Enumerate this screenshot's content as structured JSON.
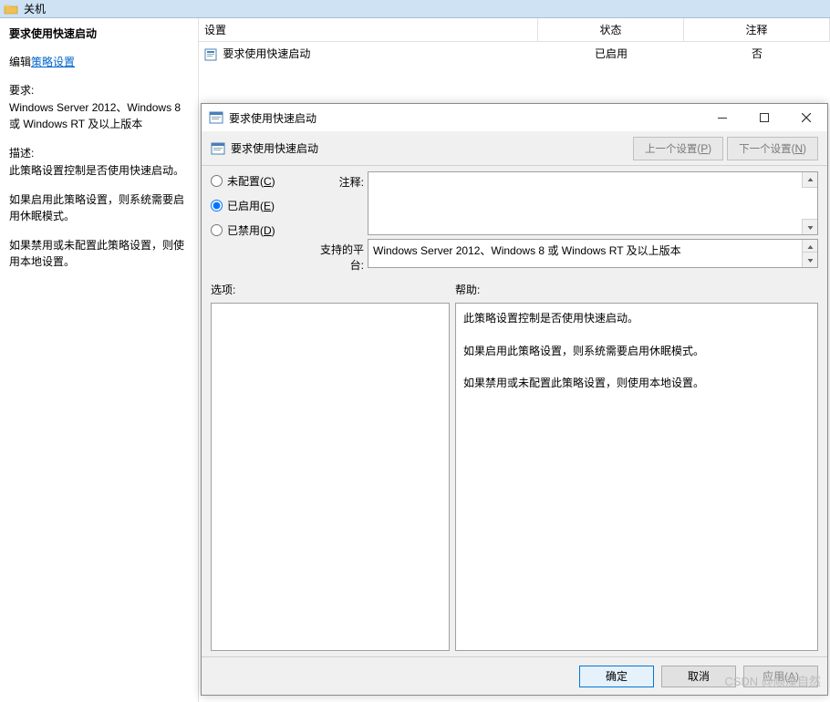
{
  "bg": {
    "title": "关机",
    "left": {
      "policy_title": "要求使用快速启动",
      "edit_prefix": "编辑",
      "edit_link": "策略设置",
      "req_label": "要求:",
      "req_text": "Windows Server 2012、Windows 8 或 Windows RT 及以上版本",
      "desc_label": "描述:",
      "desc_text": "此策略设置控制是否使用快速启动。",
      "p1": "如果启用此策略设置，则系统需要启用休眠模式。",
      "p2": "如果禁用或未配置此策略设置，则使用本地设置。"
    },
    "table": {
      "h_setting": "设置",
      "h_state": "状态",
      "h_comment": "注释",
      "r_setting": "要求使用快速启动",
      "r_state": "已启用",
      "r_comment": "否"
    }
  },
  "dialog": {
    "title": "要求使用快速启动",
    "toolbar_title": "要求使用快速启动",
    "prev_btn": "上一个设置(P)",
    "next_btn": "下一个设置(N)",
    "radio_notconfig": "未配置(C)",
    "radio_enabled": "已启用(E)",
    "radio_disabled": "已禁用(D)",
    "label_comment": "注释:",
    "label_platform": "支持的平台:",
    "platform_text": "Windows Server 2012、Windows 8 或 Windows RT 及以上版本",
    "label_options": "选项:",
    "label_help": "帮助:",
    "help_p1": "此策略设置控制是否使用快速启动。",
    "help_p2": "如果启用此策略设置，则系统需要启用休眠模式。",
    "help_p3": "如果禁用或未配置此策略设置，则使用本地设置。",
    "ok": "确定",
    "cancel": "取消",
    "apply": "应用(A)"
  },
  "watermark": "CSDN @顺溱自然"
}
